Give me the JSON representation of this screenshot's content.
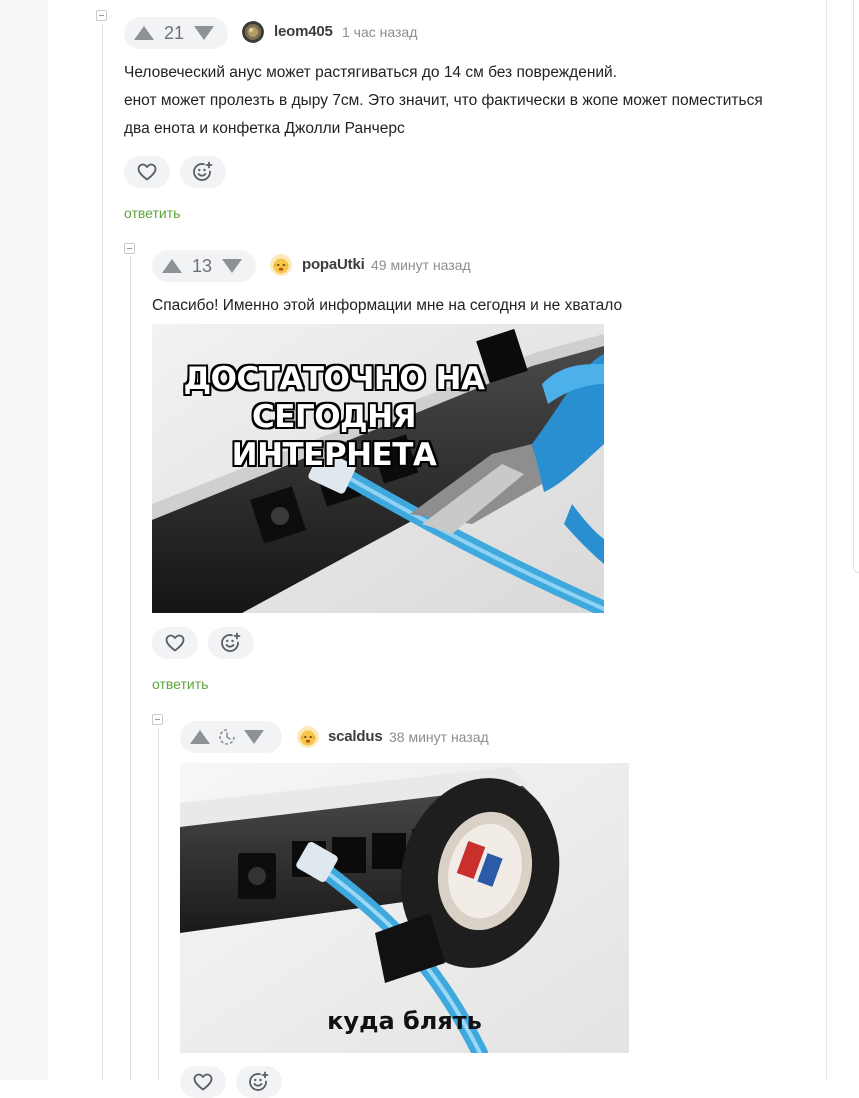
{
  "comments": [
    {
      "rating": "21",
      "author": "leom405",
      "time": "1 час назад",
      "lines": [
        "Человеческий анус может растягиваться до 14 см без повреждений.",
        "енот может пролезть в дыру 7см. Это значит, что фактически в жопе может поместиться",
        "два енота и конфетка Джолли Ранчерс"
      ],
      "reply": "ответить"
    },
    {
      "rating": "13",
      "author": "popaUtki",
      "time": "49 минут назад",
      "lines": [
        "Спасибо! Именно этой информации мне на сегодня и не хватало"
      ],
      "image_caption_line1": "ДОСТАТОЧНО НА",
      "image_caption_line2": "СЕГОДНЯ ИНТЕРНЕТА",
      "reply": "ответить"
    },
    {
      "rating": "",
      "author": "scaldus",
      "time": "38 минут назад",
      "image_caption": "куда блять"
    }
  ],
  "colors": {
    "accent_green": "#5fa23e",
    "pill_bg": "#f2f3f5",
    "icon_gray": "#8d9196"
  },
  "icons": [
    "collapse-icon",
    "upvote-icon",
    "downvote-icon",
    "heart-icon",
    "emoji-add-icon",
    "pending-rating-icon"
  ]
}
